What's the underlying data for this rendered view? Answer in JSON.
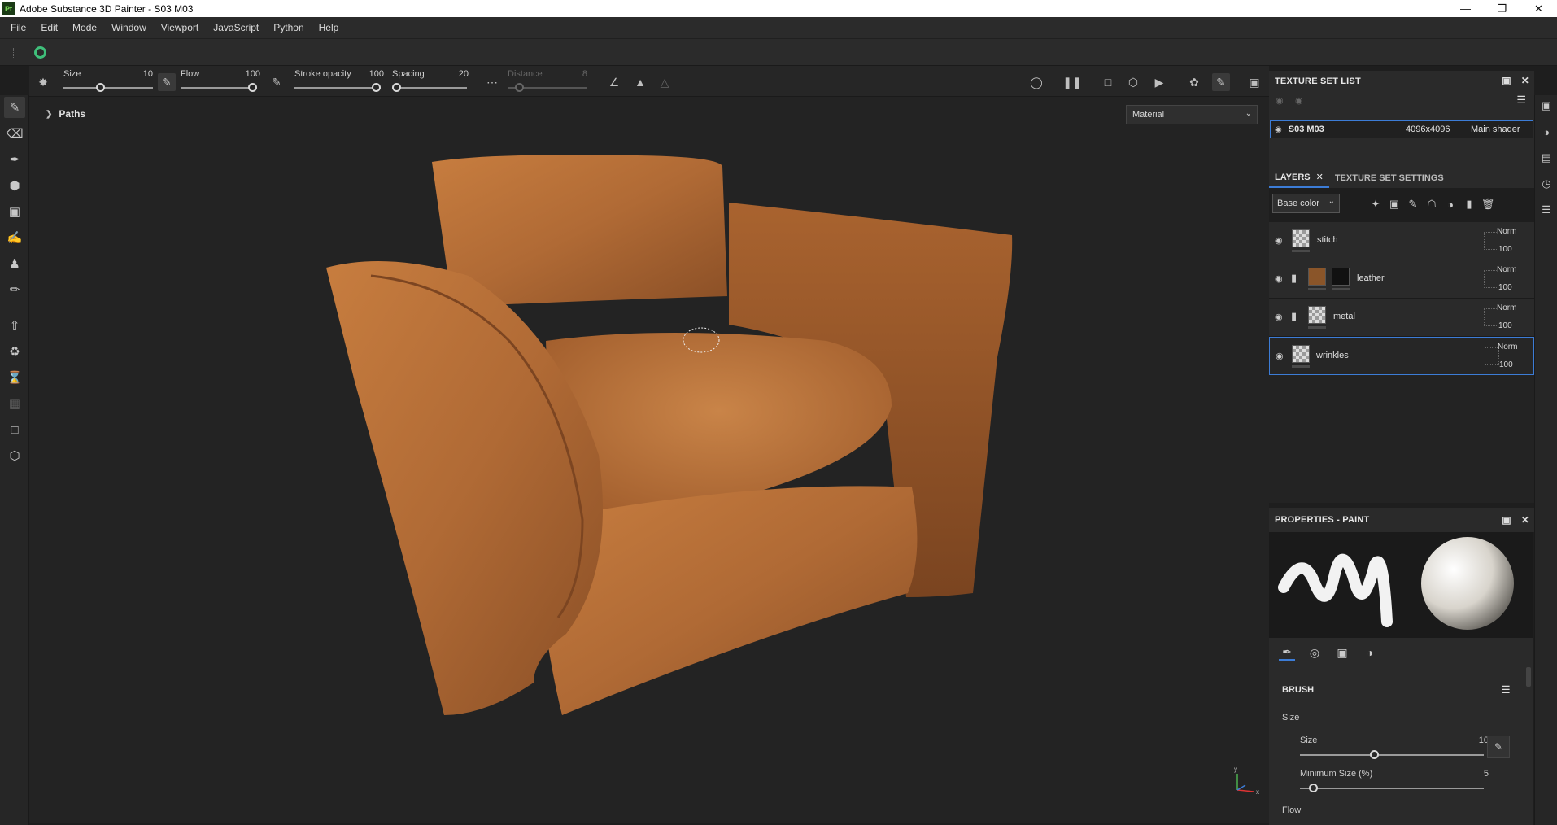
{
  "window": {
    "title": "Adobe Substance 3D Painter - S03 M03",
    "logo": "Pt"
  },
  "menu": [
    "File",
    "Edit",
    "Mode",
    "Window",
    "Viewport",
    "JavaScript",
    "Python",
    "Help"
  ],
  "toolbar": {
    "size": {
      "label": "Size",
      "value": "10",
      "level": 0.4
    },
    "flow": {
      "label": "Flow",
      "value": "100",
      "level": 1.0
    },
    "stroke_opacity": {
      "label": "Stroke opacity",
      "value": "100",
      "level": 1.0
    },
    "spacing": {
      "label": "Spacing",
      "value": "20",
      "level": 0.0
    },
    "distance": {
      "label": "Distance",
      "value": "8",
      "level": 0.1
    }
  },
  "viewport": {
    "paths_label": "Paths",
    "material_mode": "Material",
    "axis": {
      "x": "x",
      "y": "y"
    }
  },
  "texture_set_list": {
    "title": "TEXTURE SET LIST",
    "row": {
      "name": "S03 M03",
      "resolution": "4096x4096",
      "shader": "Main shader"
    }
  },
  "layers": {
    "tab_label": "LAYERS",
    "tab2_label": "TEXTURE SET SETTINGS",
    "channel": "Base color",
    "items": [
      {
        "name": "stitch",
        "blend": "Norm",
        "opacity": "100"
      },
      {
        "name": "leather",
        "blend": "Norm",
        "opacity": "100"
      },
      {
        "name": "metal",
        "blend": "Norm",
        "opacity": "100"
      },
      {
        "name": "wrinkles",
        "blend": "Norm",
        "opacity": "100"
      }
    ]
  },
  "properties": {
    "title": "PROPERTIES - PAINT",
    "section": "BRUSH",
    "size_group": "Size",
    "size_label": "Size",
    "size_value": "10",
    "size_level": 0.4,
    "min_size_label": "Minimum Size (%)",
    "min_size_value": "5",
    "min_size_level": 0.05,
    "flow_group": "Flow"
  },
  "colors": {
    "accent": "#3c7cd6",
    "sync_green": "#3fbf7a",
    "leather": "#b06a35"
  }
}
